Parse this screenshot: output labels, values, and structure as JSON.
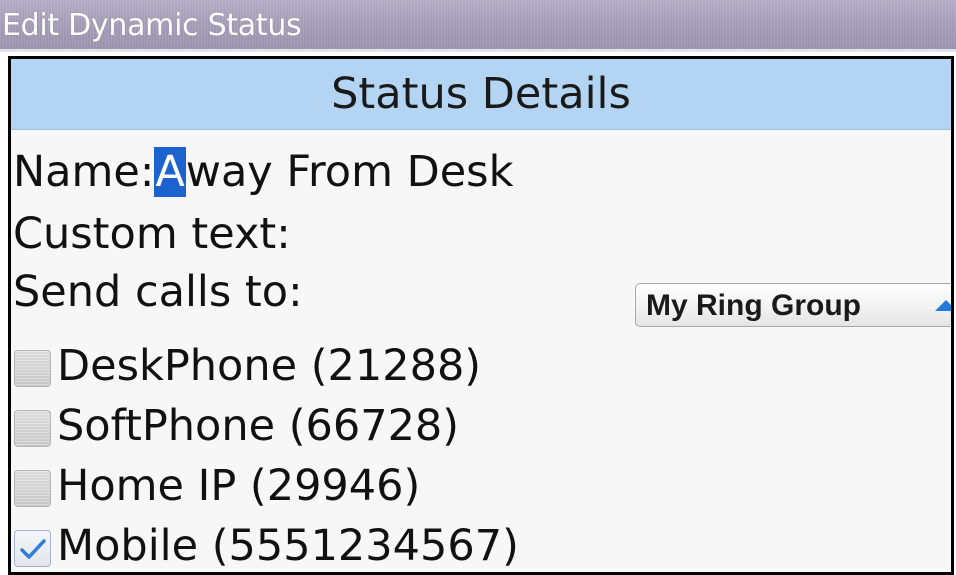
{
  "window": {
    "title": "Edit Dynamic Status"
  },
  "section": {
    "header": "Status Details"
  },
  "fields": {
    "name_label": "Name:",
    "name_cursor_char": "A",
    "name_rest": "way From Desk",
    "custom_text_label": "Custom text:",
    "send_calls_label": "Send calls to:",
    "send_calls_value": "My Ring Group"
  },
  "destinations": [
    {
      "label": "DeskPhone (21288)",
      "checked": false
    },
    {
      "label": "SoftPhone (66728)",
      "checked": false
    },
    {
      "label": "Home IP (29946)",
      "checked": false
    },
    {
      "label": "Mobile (5551234567)",
      "checked": true
    }
  ],
  "colors": {
    "title_bar": "#a59cb6",
    "header_bg": "#b3d5f3",
    "cursor_highlight": "#1c63cf",
    "dropdown_arrow": "#1f7ad8",
    "checkmark": "#2f7fd6"
  },
  "icons": {
    "dropdown_arrow": "triangle-up-icon",
    "checkmark": "checkmark-icon"
  }
}
